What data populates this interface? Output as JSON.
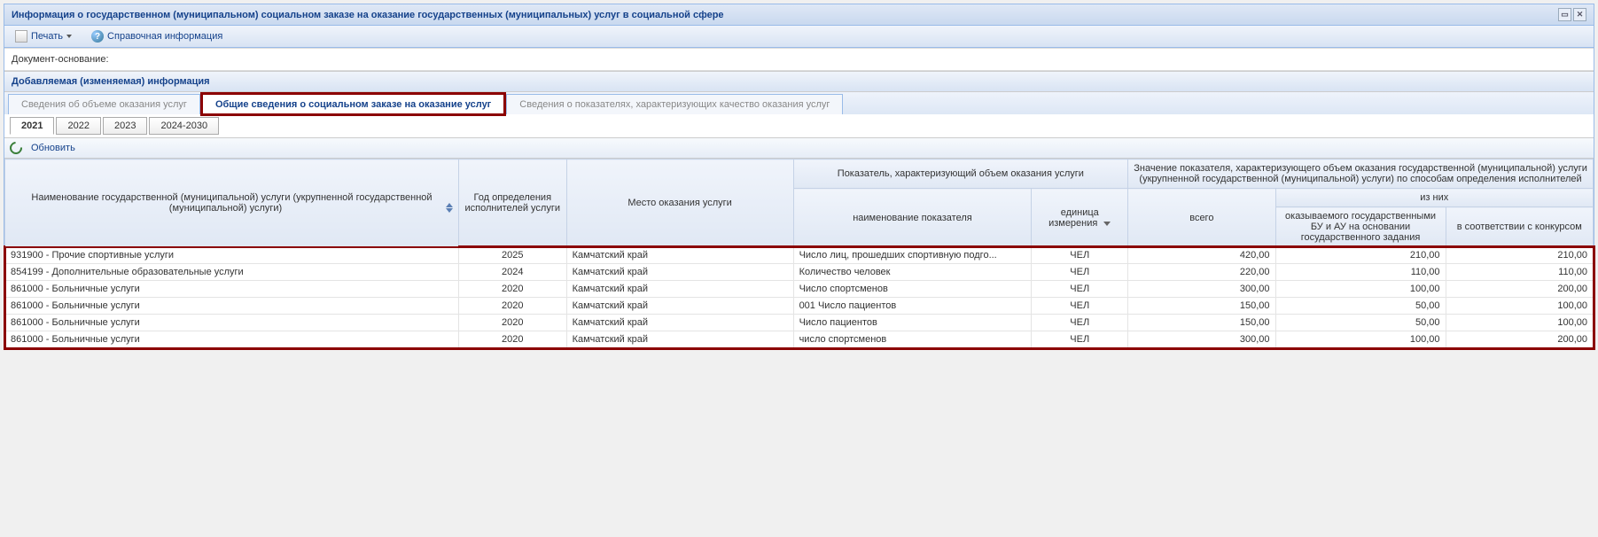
{
  "window": {
    "title": "Информация о государственном (муниципальном) социальном заказе на оказание государственных (муниципальных) услуг в социальной сфере"
  },
  "toolbar": {
    "print": "Печать",
    "help": "Справочная информация"
  },
  "docbase_label": "Документ-основание:",
  "section_title": "Добавляемая (изменяемая) информация",
  "main_tabs": [
    {
      "label": "Сведения об объеме оказания услуг"
    },
    {
      "label": "Общие сведения о социальном заказе на оказание услуг"
    },
    {
      "label": "Сведения о показателях, характеризующих качество оказания услуг"
    }
  ],
  "year_tabs": [
    "2021",
    "2022",
    "2023",
    "2024-2030"
  ],
  "grid_toolbar": {
    "refresh": "Обновить"
  },
  "columns": {
    "name": "Наименование государственной (муниципальной) услуги (укрупненной государственной (муниципальной) услуги)",
    "year": "Год определения исполнителей услуги",
    "place": "Место оказания услуги",
    "indicator_group": "Показатель, характеризующий объем оказания услуги",
    "indicator_name": "наименование показателя",
    "unit": "единица измерения",
    "value_group": "Значение показателя, характеризующего объем оказания государственной (муниципальной) услуги (укрупненной государственной (муниципальной) услуги) по способам определения исполнителей",
    "total": "всего",
    "ofthem": "из них",
    "bu_au": "оказываемого государственными БУ и АУ на основании государственного задания",
    "contest": "в соответствии с конкурсом"
  },
  "rows": [
    {
      "name": "931900 - Прочие спортивные услуги",
      "year": "2025",
      "place": "Камчатский край",
      "indicator": "Число лиц, прошедших спортивную подго...",
      "unit": "ЧЕЛ",
      "total": "420,00",
      "bu": "210,00",
      "contest": "210,00"
    },
    {
      "name": "854199 - Дополнительные образовательные услуги",
      "year": "2024",
      "place": "Камчатский край",
      "indicator": "Количество человек",
      "unit": "ЧЕЛ",
      "total": "220,00",
      "bu": "110,00",
      "contest": "110,00"
    },
    {
      "name": "861000 - Больничные услуги",
      "year": "2020",
      "place": "Камчатский край",
      "indicator": "Число спортсменов",
      "unit": "ЧЕЛ",
      "total": "300,00",
      "bu": "100,00",
      "contest": "200,00"
    },
    {
      "name": "861000 - Больничные услуги",
      "year": "2020",
      "place": "Камчатский край",
      "indicator": "001 Число пациентов",
      "unit": "ЧЕЛ",
      "total": "150,00",
      "bu": "50,00",
      "contest": "100,00"
    },
    {
      "name": "861000 - Больничные услуги",
      "year": "2020",
      "place": "Камчатский край",
      "indicator": "Число пациентов",
      "unit": "ЧЕЛ",
      "total": "150,00",
      "bu": "50,00",
      "contest": "100,00"
    },
    {
      "name": "861000 - Больничные услуги",
      "year": "2020",
      "place": "Камчатский край",
      "indicator": "число спортсменов",
      "unit": "ЧЕЛ",
      "total": "300,00",
      "bu": "100,00",
      "contest": "200,00"
    }
  ]
}
